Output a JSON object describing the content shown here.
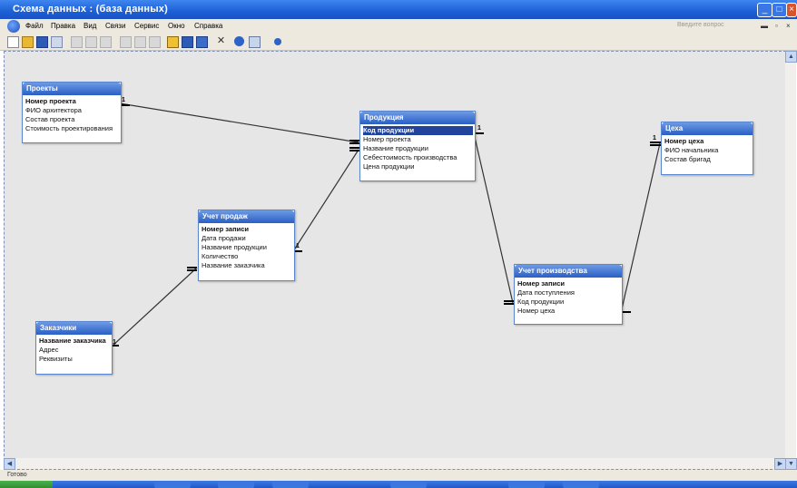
{
  "window": {
    "title": "Схема данных : (база данных)"
  },
  "menu": [
    "Файл",
    "Правка",
    "Вид",
    "Связи",
    "Сервис",
    "Окно",
    "Справка"
  ],
  "help_placeholder": "Введите вопрос",
  "status": "Готово",
  "tables": [
    {
      "name": "Проекты",
      "fields": [
        "Номер проекта",
        "ФИО архитектора",
        "Состав проекта",
        "Стоимость проектирования"
      ],
      "keys": [
        0
      ],
      "selected": null
    },
    {
      "name": "Продукция",
      "fields": [
        "Код продукции",
        "Номер проекта",
        "Название продукции",
        "Себестоимость производства",
        "Цена продукции"
      ],
      "keys": [
        0
      ],
      "selected": 0
    },
    {
      "name": "Цеха",
      "fields": [
        "Номер цеха",
        "ФИО начальника",
        "Состав бригад"
      ],
      "keys": [
        0
      ],
      "selected": null
    },
    {
      "name": "Учет продаж",
      "fields": [
        "Номер записи",
        "Дата продажи",
        "Название продукции",
        "Количество",
        "Название заказчика"
      ],
      "keys": [
        0
      ],
      "selected": null
    },
    {
      "name": "Заказчики",
      "fields": [
        "Название заказчика",
        "Адрес",
        "Реквизиты"
      ],
      "keys": [
        0
      ],
      "selected": null
    },
    {
      "name": "Учет производства",
      "fields": [
        "Номер записи",
        "Дата поступления",
        "Код продукции",
        "Номер цеха"
      ],
      "keys": [
        0
      ],
      "selected": null
    }
  ],
  "relationships": [
    {
      "from": "Проекты",
      "to": "Продукция",
      "one": "1",
      "many": "∞"
    },
    {
      "from": "Учет продаж",
      "to": "Продукция",
      "one": "1",
      "many": "∞"
    },
    {
      "from": "Заказчики",
      "to": "Учет продаж",
      "one": "1",
      "many": "∞"
    },
    {
      "from": "Продукция",
      "to": "Учет производства",
      "one": "1",
      "many": "∞"
    },
    {
      "from": "Цеха",
      "to": "Учет производства",
      "one": "1",
      "many": "∞"
    }
  ],
  "icons": {
    "toolbar": [
      "new-icon",
      "open-icon",
      "save-icon",
      "print-preview-icon",
      "print-icon",
      "spelling-icon",
      "cut-icon",
      "copy-icon",
      "paste-icon",
      "show-table-icon",
      "show-direct-relationships-icon",
      "show-all-relationships-icon",
      "delete-icon",
      "database-window-icon",
      "new-object-icon",
      "help-icon"
    ]
  }
}
